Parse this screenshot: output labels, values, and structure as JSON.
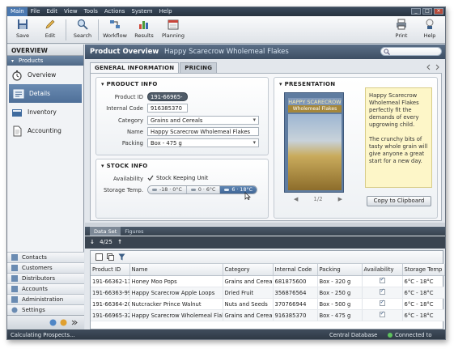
{
  "menu": [
    "Main",
    "File",
    "Edit",
    "View",
    "Tools",
    "Actions",
    "System",
    "Help"
  ],
  "toolbar": {
    "save": "Save",
    "edit": "Edit",
    "search": "Search",
    "workflow": "Workflow",
    "results": "Results",
    "planning": "Planning",
    "print": "Print",
    "help": "Help"
  },
  "nav": {
    "header": "OVERVIEW",
    "group": "Products",
    "items": [
      "Overview",
      "Details",
      "Inventory",
      "Accounting"
    ],
    "bottom": [
      "Contacts",
      "Customers",
      "Distributors",
      "Accounts",
      "Administration",
      "Settings"
    ]
  },
  "overview": {
    "title": "Product Overview",
    "product": "Happy Scarecrow Wholemeal Flakes",
    "tabs": [
      "GENERAL INFORMATION",
      "PRICING"
    ],
    "product_info": {
      "title": "PRODUCT INFO",
      "labels": {
        "id": "Product ID",
        "code": "Internal Code",
        "category": "Category",
        "name": "Name",
        "packing": "Packing"
      },
      "values": {
        "id": "191-66965-32",
        "code": "916385370",
        "category": "Grains and Cereals",
        "name": "Happy Scarecrow Wholemeal Flakes",
        "packing": "Box - 475 g"
      }
    },
    "stock_info": {
      "title": "STOCK INFO",
      "availability_label": "Availability",
      "availability_value": "Stock Keeping Unit",
      "storage_label": "Storage Temp.",
      "temps": [
        "-18 · 0°C",
        "0 · 6°C",
        "6 · 18°C"
      ]
    },
    "presentation": {
      "title": "PRESENTATION",
      "book_title_1": "HAPPY SCARECROW",
      "book_title_2": "Wholemeal Flakes",
      "note_p1": "Happy Scarecrow Wholemeal Flakes perfectly fit the demands of every upgrowing child.",
      "note_p2": "The crunchy bits of tasty whole grain will give anyone a great start for a new day.",
      "pager": "1/2",
      "clip_button": "Copy to Clipboard"
    }
  },
  "dataset": {
    "tabs": [
      "Data Set",
      "Figures"
    ],
    "count": "4/25",
    "columns": [
      "Product ID",
      "Name",
      "Category",
      "Internal Code",
      "Packing",
      "Availability",
      "Storage Temp"
    ],
    "rows": [
      [
        "191-66362-11",
        "Honey Moo Pops",
        "Grains and Cereals",
        "681875600",
        "Box - 320 g",
        "",
        "6°C - 18°C"
      ],
      [
        "191-66363-99",
        "Happy Scarecrow Apple Loops",
        "Dried Fruit",
        "356876564",
        "Box - 250 g",
        "",
        "6°C - 18°C"
      ],
      [
        "191-66364-20",
        "Nutcracker Prince Walnut",
        "Nuts and Seeds",
        "370766944",
        "Box - 500 g",
        "",
        "6°C - 18°C"
      ],
      [
        "191-66965-32",
        "Happy Scarecrow Wholemeal Flakes",
        "Grains and Cereals",
        "916385370",
        "Box - 475 g",
        "",
        "6°C - 18°C"
      ]
    ]
  },
  "status": {
    "left": "Calculating Prospects...",
    "db": "Central Database",
    "server": "Connected to Server"
  }
}
